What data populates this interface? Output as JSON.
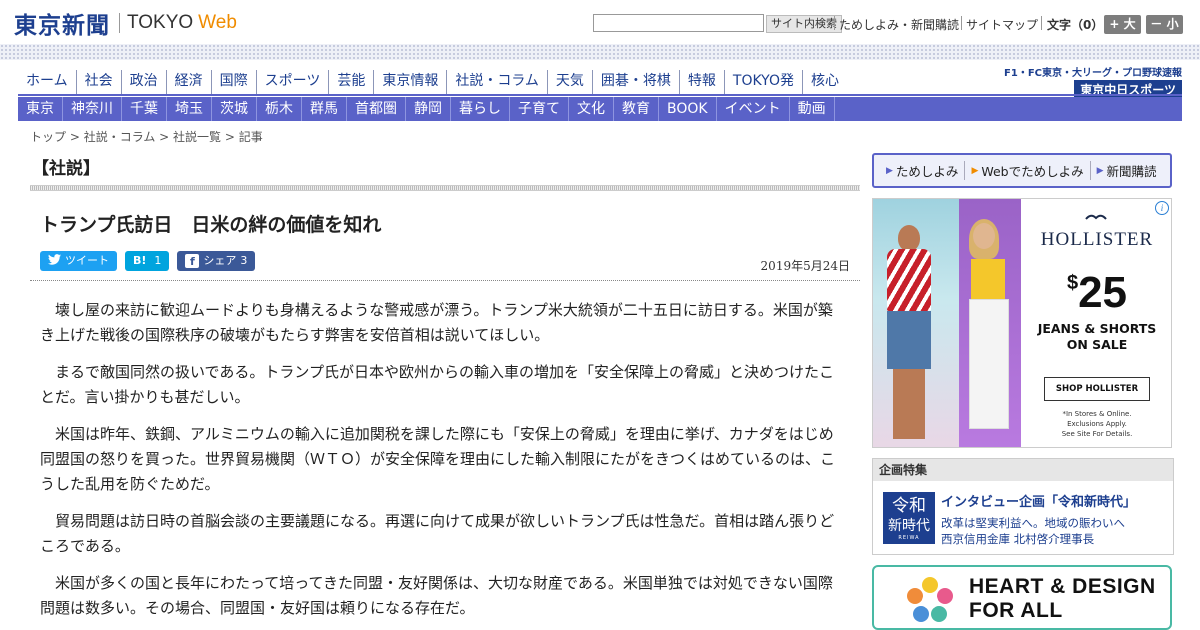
{
  "header": {
    "logo_jp": "東京新聞",
    "logo_en": "TOKYO",
    "logo_web": "Web",
    "search_placeholder": "",
    "search_button": "サイト内検索",
    "util_links": [
      "ためしよみ・新聞購読",
      "サイトマップ"
    ],
    "text_size_label": "文字（0）",
    "size_up": "+ 大",
    "size_down": "－ 小"
  },
  "main_nav": [
    "ホーム",
    "社会",
    "政治",
    "経済",
    "国際",
    "スポーツ",
    "芸能",
    "東京情報",
    "社説・コラム",
    "天気",
    "囲碁・将棋",
    "特報",
    "TOKYO発",
    "核心"
  ],
  "sports_promo": {
    "line1": "F1・FC東京・大リーグ・プロ野球速報",
    "line2": "東京中日スポーツ"
  },
  "sub_nav": [
    "東京",
    "神奈川",
    "千葉",
    "埼玉",
    "茨城",
    "栃木",
    "群馬",
    "首都圏",
    "静岡",
    "暮らし",
    "子育て",
    "文化",
    "教育",
    "BOOK",
    "イベント",
    "動画"
  ],
  "breadcrumb": {
    "items": [
      "トップ",
      "社説・コラム",
      "社説一覧"
    ],
    "current": "記事",
    "sep": " > "
  },
  "article": {
    "section": "【社説】",
    "headline": "トランプ氏訪日　日米の絆の価値を知れ",
    "share": {
      "tweet_label": "ツイート",
      "hatena_label": "B!",
      "hatena_count": "1",
      "fb_label": "シェア",
      "fb_count": "3"
    },
    "date": "2019年5月24日",
    "paragraphs": [
      "壊し屋の来訪に歓迎ムードよりも身構えるような警戒感が漂う。トランプ米大統領が二十五日に訪日する。米国が築き上げた戦後の国際秩序の破壊がもたらす弊害を安倍首相は説いてほしい。",
      "まるで敵国同然の扱いである。トランプ氏が日本や欧州からの輸入車の増加を「安全保障上の脅威」と決めつけたことだ。言い掛かりも甚だしい。",
      "米国は昨年、鉄鋼、アルミニウムの輸入に追加関税を課した際にも「安保上の脅威」を理由に挙げ、カナダをはじめ同盟国の怒りを買った。世界貿易機関（ＷＴＯ）が安全保障を理由にした輸入制限にたがをきつくはめているのは、こうした乱用を防ぐためだ。",
      "貿易問題は訪日時の首脳会談の主要議題になる。再選に向けて成果が欲しいトランプ氏は性急だ。首相は踏ん張りどころである。",
      "米国が多くの国と長年にわたって培ってきた同盟・友好関係は、大切な財産である。米国単独では対処できない国際問題は数多い。その場合、同盟国・友好国は頼りになる存在だ。"
    ]
  },
  "sidebar": {
    "trial": [
      "ためしよみ",
      "Webでためしよみ",
      "新聞購読"
    ],
    "ad": {
      "brand": "HOLLISTER",
      "price_symbol": "$",
      "price": "25",
      "sub1": "JEANS & SHORTS",
      "sub2": "ON SALE",
      "shop": "SHOP HOLLISTER",
      "fine": [
        "*In Stores & Online.",
        "Exclusions Apply.",
        "See Site For Details."
      ]
    },
    "feature": {
      "head": "企画特集",
      "thumb_line1": "令和",
      "thumb_line2": "新時代",
      "thumb_line3": "REIWA",
      "title": "インタビュー企画「令和新時代」",
      "desc1": "改革は堅実利益へ。地域の賑わいへ",
      "desc2": "西京信用金庫 北村啓介理事長"
    },
    "banner": {
      "line1": "HEART & DESIGN",
      "line2": "FOR ALL"
    }
  }
}
